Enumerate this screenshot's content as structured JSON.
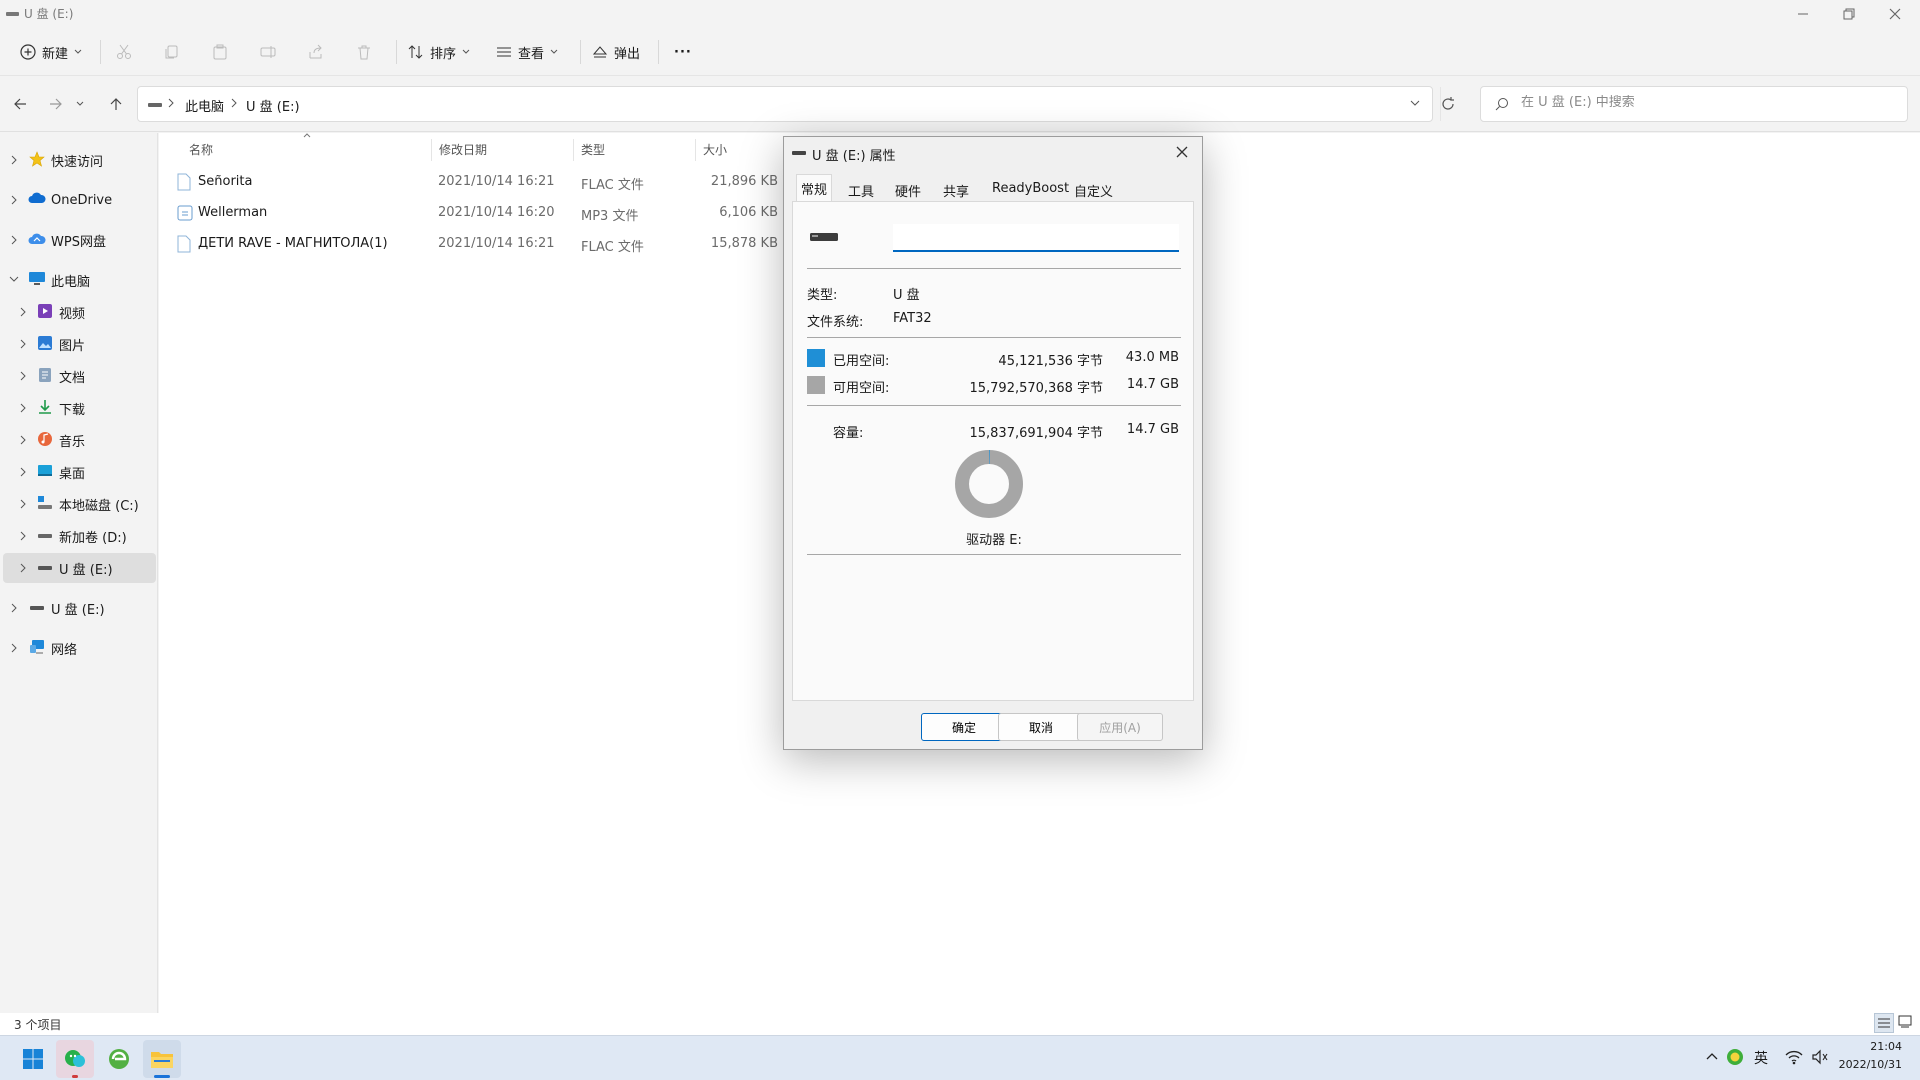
{
  "window": {
    "title": "U 盘 (E:)"
  },
  "toolbar": {
    "new_label": "新建",
    "sort_label": "排序",
    "view_label": "查看",
    "eject_label": "弹出",
    "more_label": "···"
  },
  "address": {
    "crumbs": [
      "此电脑",
      "U 盘 (E:)"
    ],
    "search_placeholder": "在 U 盘 (E:) 中搜索"
  },
  "sidebar": {
    "items": [
      {
        "label": "快速访问",
        "icon": "star-icon"
      },
      {
        "label": "OneDrive",
        "icon": "cloud-icon"
      },
      {
        "label": "WPS网盘",
        "icon": "wps-cloud-icon"
      },
      {
        "label": "此电脑",
        "icon": "computer-icon"
      },
      {
        "label": "视频",
        "icon": "video-icon"
      },
      {
        "label": "图片",
        "icon": "picture-icon"
      },
      {
        "label": "文档",
        "icon": "document-icon"
      },
      {
        "label": "下载",
        "icon": "download-icon"
      },
      {
        "label": "音乐",
        "icon": "music-icon"
      },
      {
        "label": "桌面",
        "icon": "desktop-icon"
      },
      {
        "label": "本地磁盘 (C:)",
        "icon": "disk-icon"
      },
      {
        "label": "新加卷 (D:)",
        "icon": "drive-icon"
      },
      {
        "label": "U 盘 (E:)",
        "icon": "usb-drive-icon"
      },
      {
        "label": "U 盘 (E:)",
        "icon": "usb-drive-icon"
      },
      {
        "label": "网络",
        "icon": "network-icon"
      }
    ]
  },
  "filelist": {
    "columns": [
      "名称",
      "修改日期",
      "类型",
      "大小"
    ],
    "rows": [
      {
        "name": "Señorita",
        "date": "2021/10/14 16:21",
        "type": "FLAC 文件",
        "size": "21,896 KB"
      },
      {
        "name": "Wellerman",
        "date": "2021/10/14 16:20",
        "type": "MP3 文件",
        "size": "6,106 KB"
      },
      {
        "name": "ДЕТИ RAVE - МАГНИТОЛА(1)",
        "date": "2021/10/14 16:21",
        "type": "FLAC 文件",
        "size": "15,878 KB"
      }
    ]
  },
  "status": {
    "count": "3 个项目"
  },
  "dialog": {
    "title": "U 盘 (E:) 属性",
    "tabs": [
      "常规",
      "工具",
      "硬件",
      "共享",
      "ReadyBoost",
      "自定义"
    ],
    "name_value": "",
    "type_label": "类型:",
    "type_value": "U 盘",
    "fs_label": "文件系统:",
    "fs_value": "FAT32",
    "used_label": "已用空间:",
    "used_bytes": "45,121,536 字节",
    "used_size": "43.0 MB",
    "free_label": "可用空间:",
    "free_bytes": "15,792,570,368 字节",
    "free_size": "14.7 GB",
    "cap_label": "容量:",
    "cap_bytes": "15,837,691,904 字节",
    "cap_size": "14.7 GB",
    "drive_label": "驱动器 E:",
    "used_fraction": 0.0028,
    "used_color": "#1f8fd6",
    "free_color": "#a6a6a6",
    "ok": "确定",
    "cancel": "取消",
    "apply": "应用(A)"
  },
  "taskbar": {
    "ime": "英",
    "time": "21:04",
    "date": "2022/10/31"
  }
}
